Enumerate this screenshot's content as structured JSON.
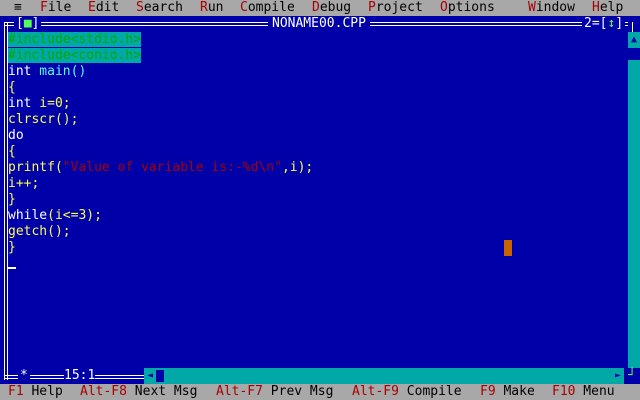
{
  "menu": {
    "system": "≡",
    "items": [
      {
        "hot": "F",
        "rest": "ile"
      },
      {
        "hot": "E",
        "rest": "dit"
      },
      {
        "hot": "S",
        "rest": "earch"
      },
      {
        "hot": "R",
        "rest": "un"
      },
      {
        "hot": "C",
        "rest": "ompile"
      },
      {
        "hot": "D",
        "rest": "ebug"
      },
      {
        "hot": "P",
        "rest": "roject"
      },
      {
        "hot": "O",
        "rest": "ptions"
      },
      {
        "hot": "W",
        "rest": "indow"
      },
      {
        "hot": "H",
        "rest": "elp"
      }
    ]
  },
  "window": {
    "close_left": "[",
    "close_mark": "■",
    "close_right": "]",
    "title": "NONAME00.CPP",
    "number": "2",
    "zoom_left": "[",
    "zoom_mark": "↕",
    "zoom_right": "]"
  },
  "code": {
    "l1": "#include<stdio.h>",
    "l2": "#include<conio.h>",
    "l3a": "int",
    "l3b": " main()",
    "l4": "{",
    "l5a": "int",
    "l5b": " i=0;",
    "l6": "clrscr();",
    "l7": "do",
    "l8": "{",
    "l9a": "printf(",
    "l9b": "\"Value of variable is:-%d\\n\"",
    "l9c": ",i);",
    "l10": "i++;",
    "l11": "}",
    "l12a": "while",
    "l12b": "(i<=3);",
    "l13": "getch();",
    "l14": "}"
  },
  "editor_status": {
    "modified_mark": "*",
    "cursor_position": "15:1"
  },
  "scroll": {
    "up_arrow": "▲",
    "down_arrow": "▼",
    "left_arrow": "◄",
    "right_arrow": "►",
    "resize_mark": "┘"
  },
  "statusbar": [
    {
      "key": "F1",
      "label": " Help"
    },
    {
      "key": "Alt-F8",
      "label": " Next Msg"
    },
    {
      "key": "Alt-F7",
      "label": " Prev Msg"
    },
    {
      "key": "Alt-F9",
      "label": " Compile"
    },
    {
      "key": "F9",
      "label": " Make"
    },
    {
      "key": "F10",
      "label": " Menu"
    }
  ]
}
